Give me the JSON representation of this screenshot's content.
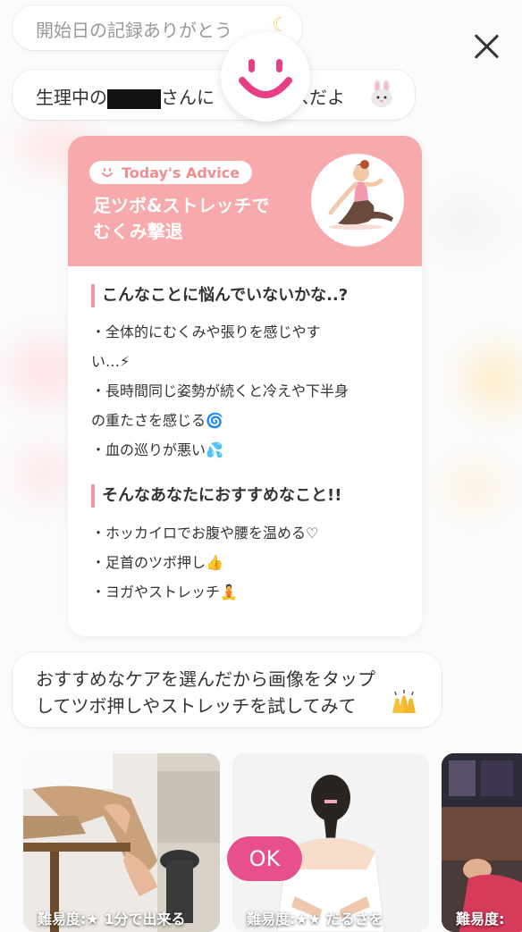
{
  "colors": {
    "accent": "#f7a9ab",
    "ok_button": "#e84f8d",
    "heading_bar": "#f39a9c"
  },
  "chat": {
    "bubble1": "開始日の記録ありがとう",
    "bubble1_icon": "moon-icon",
    "bubble2_prefix": "生理中の",
    "bubble2_mid": "さんに",
    "bubble2_suffix": "スだよ",
    "bubble2_icon": "rabbit-icon",
    "bubble3_line1": "おすすめなケアを選んだから画像をタップ",
    "bubble3_line2": "してツボ押しやストレッチを試してみて",
    "bubble3_icon": "raised-hands-icon"
  },
  "advice": {
    "badge": "Today's Advice",
    "title_line1": "足ツボ&ストレッチで",
    "title_line2": "むくみ撃退",
    "section1": "こんなことに悩んでいないかな..?",
    "section1_items": [
      "・全体的にむくみや張りを感じやす",
      "い…⚡",
      "・長時間同じ姿勢が続くと冷えや下半身",
      "の重たさを感じる🌀",
      "・血の巡りが悪い💦"
    ],
    "section2": "そんなあなたにおすすめなこと!!",
    "section2_items": [
      "・ホッカイロでお腹や腰を温める♡",
      "・足首のツボ押し👍",
      "・ヨガやストレッチ🧘"
    ]
  },
  "cards": [
    {
      "label": "難易度:★ 1分で出来る"
    },
    {
      "label": "難易度:★★ だるさを"
    },
    {
      "label": "難易度:"
    }
  ],
  "ok_label": "OK"
}
